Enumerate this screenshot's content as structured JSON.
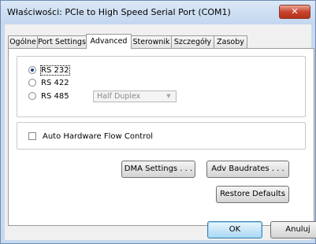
{
  "window": {
    "title": "Właściwości: PCIe to High Speed Serial Port (COM1)",
    "close_label": "✕"
  },
  "tabs": [
    {
      "label": "Ogólne",
      "active": false
    },
    {
      "label": "Port Settings",
      "active": false
    },
    {
      "label": "Advanced",
      "active": true
    },
    {
      "label": "Sterownik",
      "active": false
    },
    {
      "label": "Szczegóły",
      "active": false
    },
    {
      "label": "Zasoby",
      "active": false
    }
  ],
  "interface_mode": {
    "options": [
      {
        "label": "RS 232",
        "checked": true
      },
      {
        "label": "RS 422",
        "checked": false
      },
      {
        "label": "RS 485",
        "checked": false
      }
    ],
    "duplex_select": {
      "value": "Half Duplex",
      "enabled": false
    }
  },
  "flow_control": {
    "label": "Auto Hardware Flow Control",
    "checked": false
  },
  "buttons": {
    "dma_settings": "DMA Settings . . .",
    "adv_baudrates": "Adv Baudrates . . .",
    "restore_defaults": "Restore Defaults"
  },
  "dialog_buttons": {
    "ok": "OK",
    "cancel": "Anuluj"
  },
  "colors": {
    "radio_dot": "#1c3e83",
    "disabled_text": "#8a8a8a",
    "default_button_border": "#3c7fb1"
  }
}
